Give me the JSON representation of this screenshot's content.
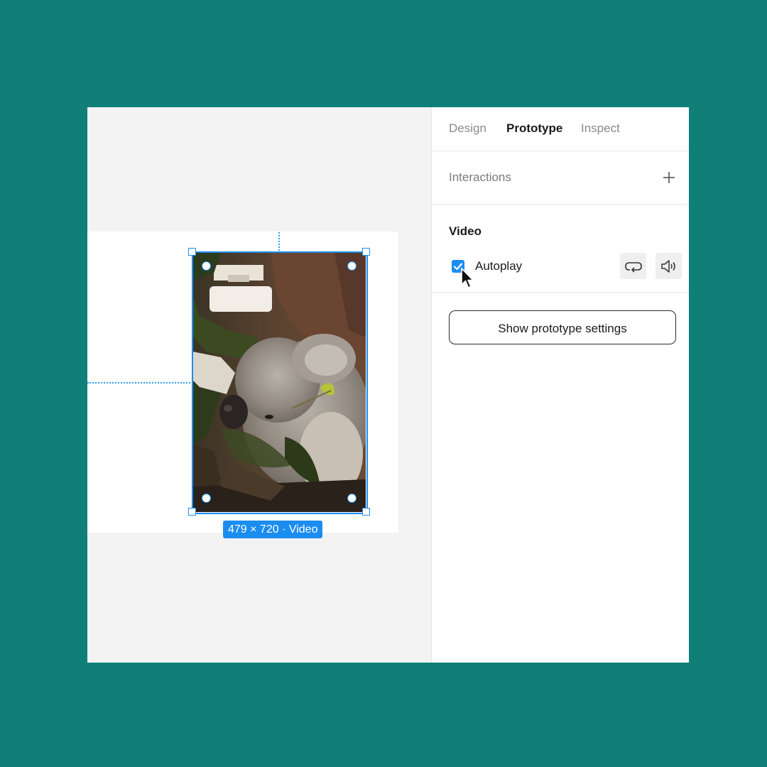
{
  "canvas": {
    "selection_label": "479 × 720 · Video"
  },
  "tabs": [
    {
      "label": "Design",
      "active": false
    },
    {
      "label": "Prototype",
      "active": true
    },
    {
      "label": "Inspect",
      "active": false
    }
  ],
  "interactions": {
    "label": "Interactions",
    "add_icon": "plus-icon"
  },
  "video": {
    "heading": "Video",
    "autoplay_label": "Autoplay",
    "autoplay_checked": true,
    "loop_icon": "loop-icon",
    "sound_icon": "speaker-icon"
  },
  "settings_button": "Show prototype settings",
  "colors": {
    "background": "#0f7f78",
    "accent": "#1b8df0"
  }
}
